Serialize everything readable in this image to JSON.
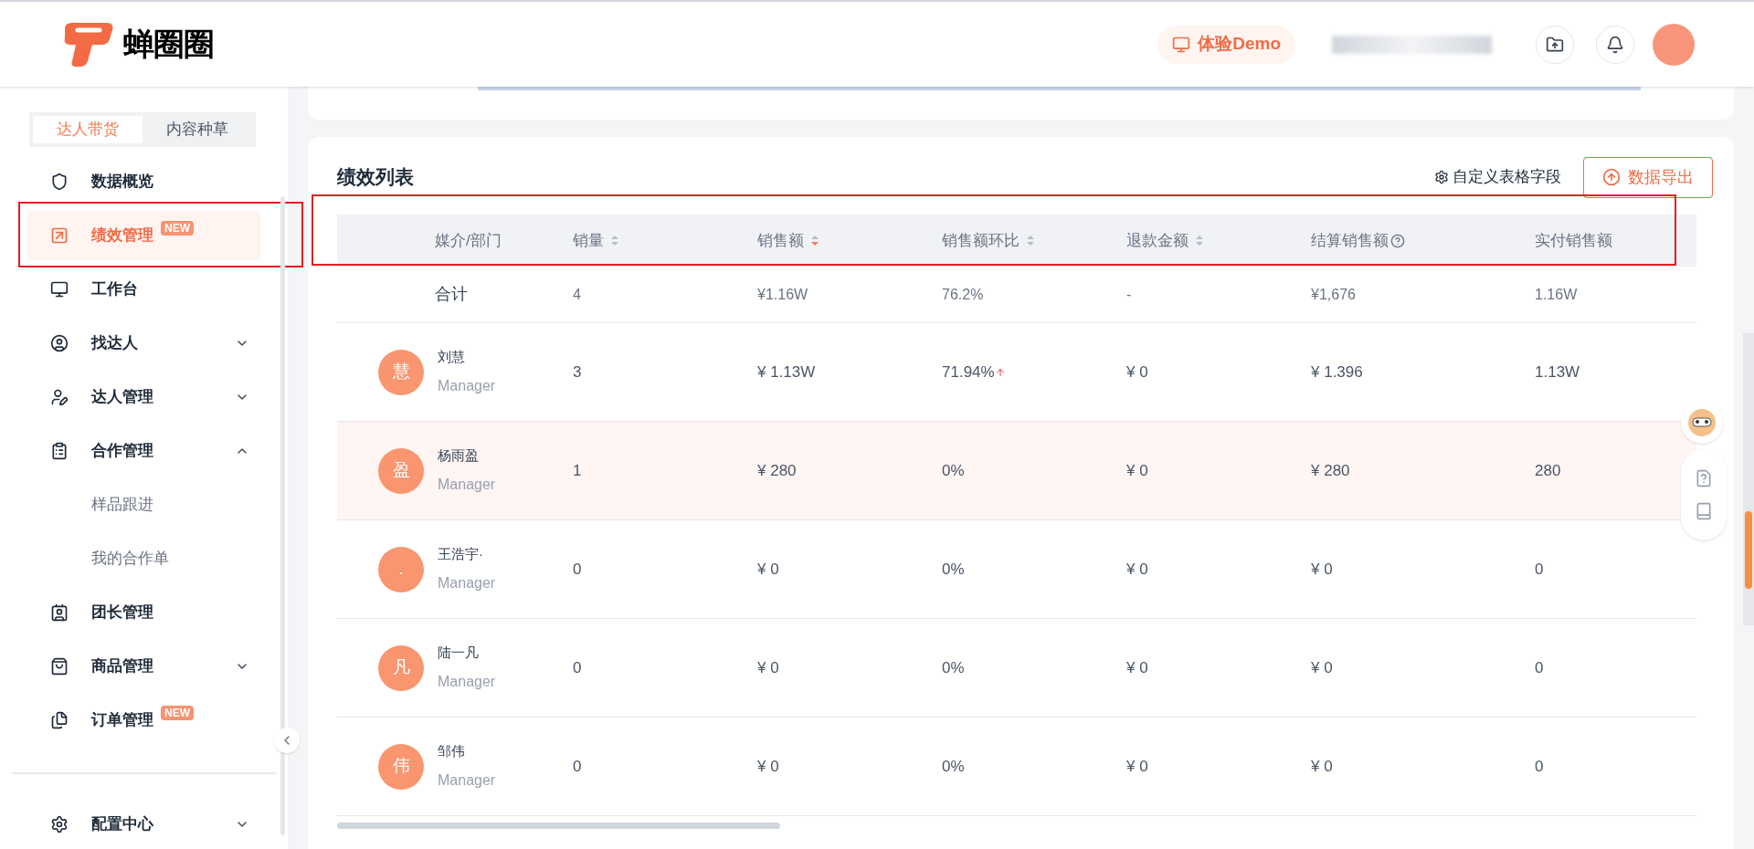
{
  "header": {
    "logo_text": "蝉圈圈",
    "demo_button": "体验Demo"
  },
  "sidebar": {
    "tabs": [
      {
        "label": "达人带货",
        "selected": true
      },
      {
        "label": "内容种草",
        "selected": false
      }
    ],
    "items": [
      {
        "label": "数据概览",
        "selected": false,
        "highlighted": false,
        "kind": "main"
      },
      {
        "label": "绩效管理",
        "selected": true,
        "highlighted": true,
        "badge": "NEW",
        "kind": "main"
      },
      {
        "label": "工作台",
        "selected": false,
        "highlighted": false,
        "kind": "main"
      },
      {
        "label": "找达人",
        "selected": false,
        "highlighted": false,
        "expanded": false,
        "kind": "main"
      },
      {
        "label": "达人管理",
        "selected": false,
        "highlighted": false,
        "expanded": false,
        "kind": "main"
      },
      {
        "label": "合作管理",
        "selected": false,
        "highlighted": false,
        "expanded": true,
        "kind": "main"
      },
      {
        "label": "样品跟进",
        "selected": false,
        "highlighted": false,
        "kind": "sub"
      },
      {
        "label": "我的合作单",
        "selected": false,
        "highlighted": false,
        "kind": "sub"
      },
      {
        "label": "团长管理",
        "selected": false,
        "highlighted": false,
        "kind": "main"
      },
      {
        "label": "商品管理",
        "selected": false,
        "highlighted": false,
        "expanded": false,
        "kind": "main"
      },
      {
        "label": "订单管理",
        "selected": false,
        "highlighted": false,
        "badge": "NEW",
        "kind": "main"
      }
    ],
    "footer_item": {
      "label": "配置中心",
      "expanded": false
    }
  },
  "performance": {
    "title": "绩效列表",
    "customize_link": "自定义表格字段",
    "export_button": "数据导出",
    "table": {
      "highlighted": true,
      "columns": [
        {
          "label": "媒介/部门",
          "sortable": false,
          "help": false
        },
        {
          "label": "销量",
          "sortable": true,
          "sorted_desc": false,
          "help": false
        },
        {
          "label": "销售额",
          "sortable": true,
          "sorted_desc": true,
          "help": false
        },
        {
          "label": "销售额环比",
          "sortable": true,
          "sorted_desc": false,
          "help": false
        },
        {
          "label": "退款金额",
          "sortable": true,
          "sorted_desc": false,
          "help": false
        },
        {
          "label": "结算销售额",
          "sortable": false,
          "help": true
        },
        {
          "label": "实付销售额",
          "sortable": false,
          "help": false
        }
      ],
      "total": {
        "cells": [
          "合计",
          "4",
          "¥1.16W",
          "76.2%",
          "-",
          "¥1,676",
          "1.16W"
        ]
      },
      "rows": [
        {
          "avatar": "慧",
          "role": "Manager",
          "selected": false,
          "trend_up": true,
          "cells": [
            "刘慧",
            "3",
            "¥ 1.13W",
            "71.94%",
            "¥ 0",
            "¥ 1.396",
            "1.13W"
          ]
        },
        {
          "avatar": "盈",
          "role": "Manager",
          "selected": true,
          "trend_up": false,
          "cells": [
            "杨雨盈",
            "1",
            "¥ 280",
            "0%",
            "¥ 0",
            "¥ 280",
            "280"
          ]
        },
        {
          "avatar": ".",
          "role": "Manager",
          "selected": false,
          "trend_up": false,
          "cells": [
            "王浩宇·",
            "0",
            "¥ 0",
            "0%",
            "¥ 0",
            "¥ 0",
            "0"
          ]
        },
        {
          "avatar": "凡",
          "role": "Manager",
          "selected": false,
          "trend_up": false,
          "cells": [
            "陆一凡",
            "0",
            "¥ 0",
            "0%",
            "¥ 0",
            "¥ 0",
            "0"
          ]
        },
        {
          "avatar": "伟",
          "role": "Manager",
          "selected": false,
          "trend_up": false,
          "cells": [
            "邹伟",
            "0",
            "¥ 0",
            "0%",
            "¥ 0",
            "¥ 0",
            "0"
          ]
        }
      ]
    }
  }
}
